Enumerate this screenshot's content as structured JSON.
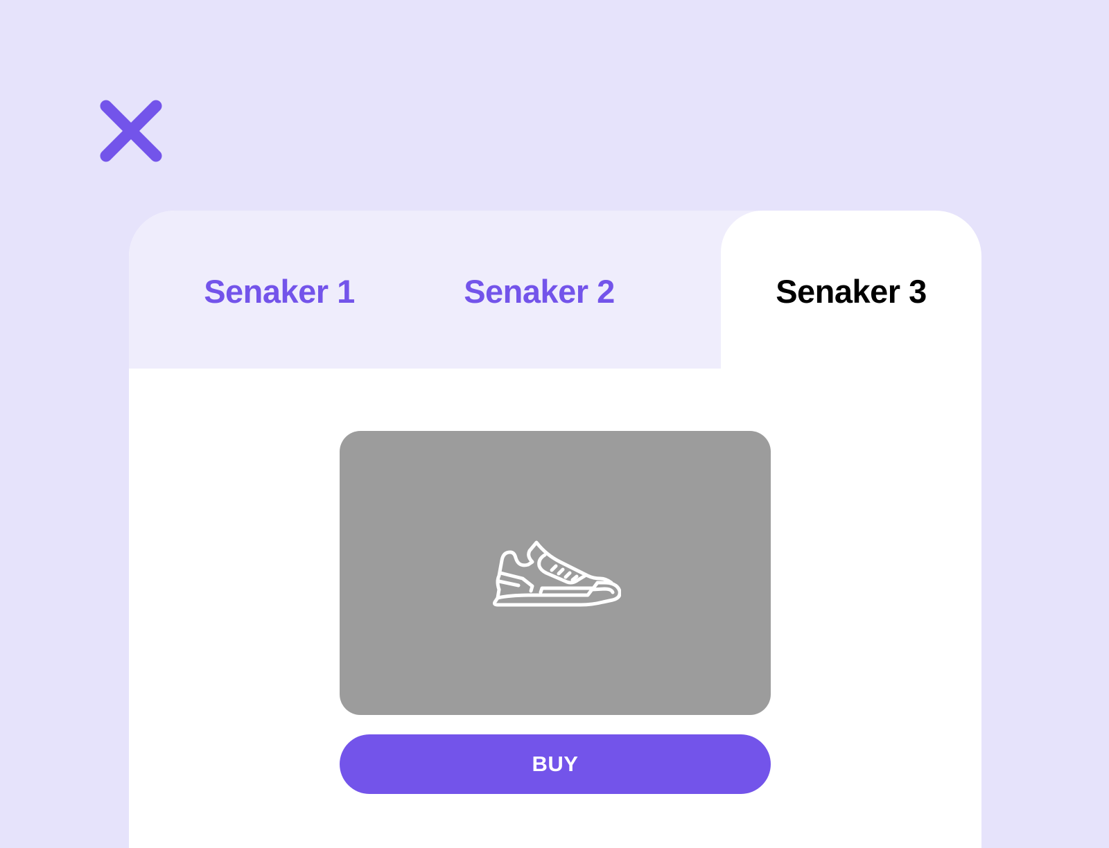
{
  "header": {
    "close_icon": "close-icon"
  },
  "tabs": [
    {
      "label": "Senaker 1",
      "active": false
    },
    {
      "label": "Senaker 2",
      "active": false
    },
    {
      "label": "Senaker 3",
      "active": true
    }
  ],
  "product": {
    "image_icon": "sneaker-icon",
    "buy_label": "BUY"
  },
  "colors": {
    "background": "#e6e3fb",
    "accent": "#7354ea",
    "tab_bar": "#efedfc",
    "card": "#ffffff",
    "image_placeholder": "#9c9c9c",
    "active_tab_text": "#000000"
  }
}
